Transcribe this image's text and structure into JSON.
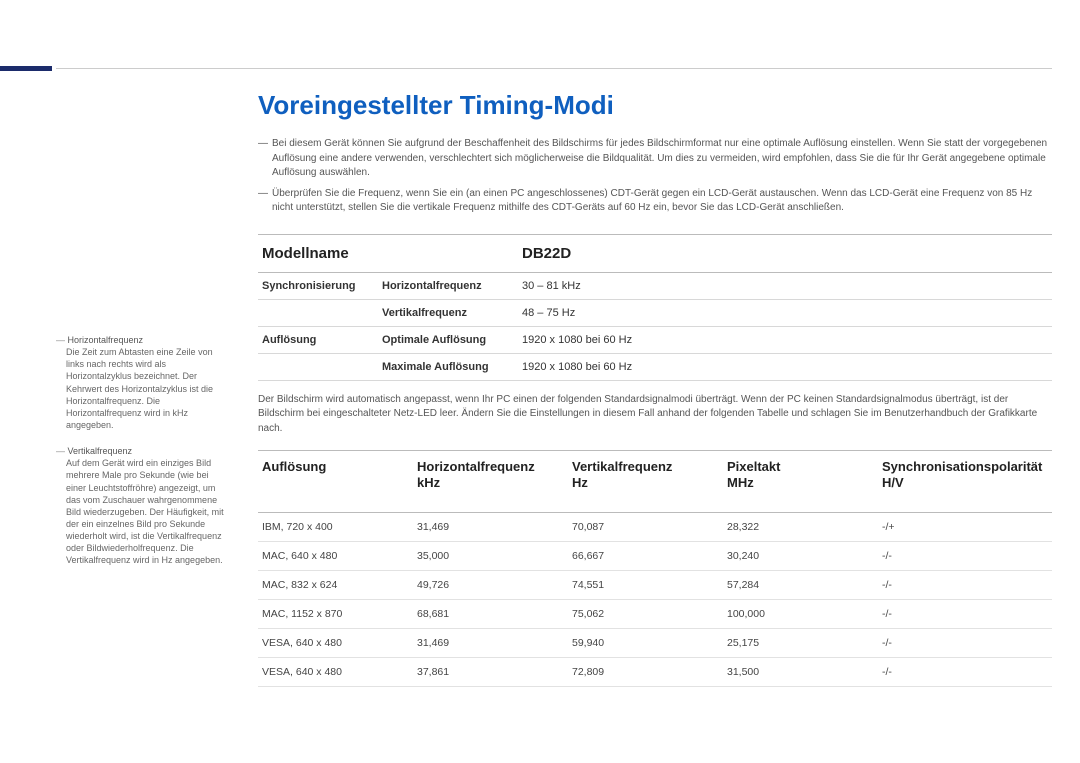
{
  "title": "Voreingestellter Timing-Modi",
  "notes": [
    "Bei diesem Gerät können Sie aufgrund der Beschaffenheit des Bildschirms für jedes Bildschirmformat nur eine optimale Auflösung einstellen. Wenn Sie statt der vorgegebenen Auflösung eine andere verwenden, verschlechtert sich möglicherweise die Bildqualität. Um dies zu vermeiden, wird empfohlen, dass Sie die für Ihr Gerät angegebene optimale Auflösung auswählen.",
    "Überprüfen Sie die Frequenz, wenn Sie ein (an einen PC angeschlossenes) CDT-Gerät gegen ein LCD-Gerät austauschen. Wenn das LCD-Gerät eine Frequenz von 85 Hz nicht unterstützt, stellen Sie die vertikale Frequenz mithilfe des CDT-Geräts auf 60 Hz ein, bevor Sie das LCD-Gerät anschließen."
  ],
  "specs": {
    "header_label": "Modellname",
    "header_value": "DB22D",
    "rows": [
      {
        "group": "Synchronisierung",
        "label": "Horizontalfrequenz",
        "value": "30 – 81 kHz"
      },
      {
        "group": "",
        "label": "Vertikalfrequenz",
        "value": "48 – 75 Hz"
      },
      {
        "group": "Auflösung",
        "label": "Optimale Auflösung",
        "value": "1920 x 1080 bei 60 Hz"
      },
      {
        "group": "",
        "label": "Maximale Auflösung",
        "value": "1920 x 1080 bei 60 Hz"
      }
    ]
  },
  "mid_text": "Der Bildschirm wird automatisch angepasst, wenn Ihr PC einen der folgenden Standardsignalmodi überträgt. Wenn der PC keinen Standardsignalmodus überträgt, ist der Bildschirm bei eingeschalteter Netz-LED leer. Ändern Sie die Einstellungen in diesem Fall anhand der folgenden Tabelle und schlagen Sie im Benutzerhandbuch der Grafikkarte nach.",
  "timing": {
    "headers": [
      "Auflösung",
      "Horizontalfrequenz kHz",
      "Vertikalfrequenz Hz",
      "Pixeltakt MHz",
      "Synchronisationspolarität H/V"
    ],
    "rows": [
      [
        "IBM, 720 x 400",
        "31,469",
        "70,087",
        "28,322",
        "-/+"
      ],
      [
        "MAC, 640 x 480",
        "35,000",
        "66,667",
        "30,240",
        "-/-"
      ],
      [
        "MAC, 832 x 624",
        "49,726",
        "74,551",
        "57,284",
        "-/-"
      ],
      [
        "MAC, 1152 x 870",
        "68,681",
        "75,062",
        "100,000",
        "-/-"
      ],
      [
        "VESA, 640 x 480",
        "31,469",
        "59,940",
        "25,175",
        "-/-"
      ],
      [
        "VESA, 640 x 480",
        "37,861",
        "72,809",
        "31,500",
        "-/-"
      ]
    ]
  },
  "sidebar": [
    {
      "title": "Horizontalfrequenz",
      "desc": "Die Zeit zum Abtasten eine Zeile von links nach rechts wird als Horizontalzyklus bezeichnet. Der Kehrwert des Horizontalzyklus ist die Horizontalfrequenz. Die Horizontalfrequenz wird in kHz angegeben."
    },
    {
      "title": "Vertikalfrequenz",
      "desc": "Auf dem Gerät wird ein einziges Bild mehrere Male pro Sekunde (wie bei einer Leuchtstoffröhre) angezeigt, um das vom Zuschauer wahrgenommene Bild wiederzugeben. Der Häufigkeit, mit der ein einzelnes Bild pro Sekunde wiederholt wird, ist die Vertikalfrequenz oder Bildwiederholfrequenz. Die Vertikalfrequenz wird in Hz angegeben."
    }
  ]
}
